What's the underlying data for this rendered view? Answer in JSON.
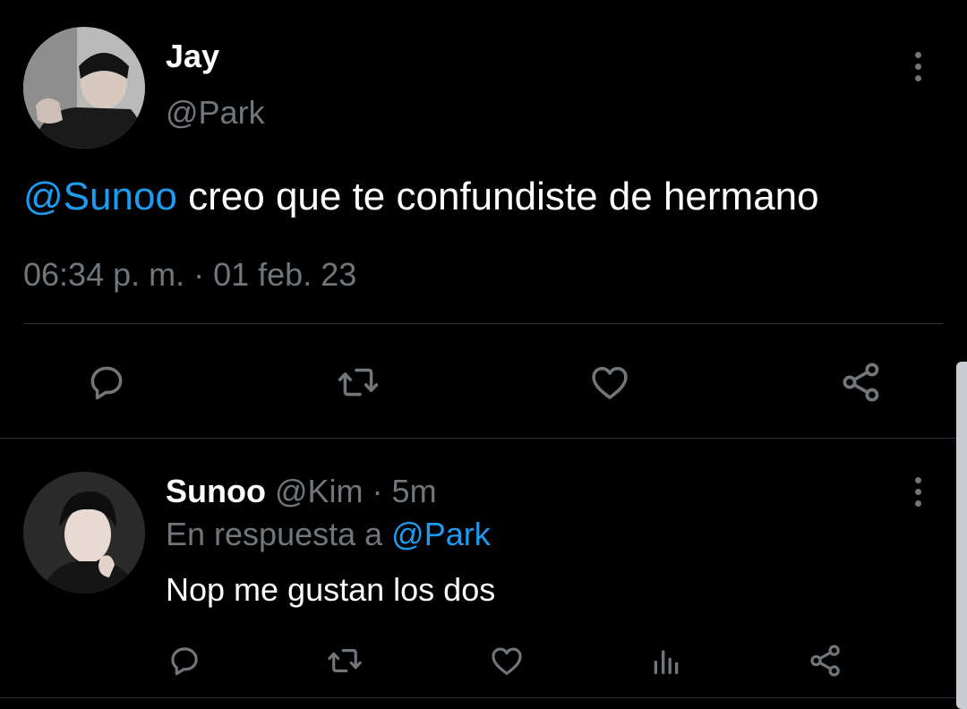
{
  "main_tweet": {
    "author_name": "Jay",
    "author_handle": "@Park",
    "mention": "@Sunoo",
    "text": " creo que te confundiste de hermano",
    "timestamp": "06:34 p. m. · 01 feb. 23",
    "actions": [
      "reply-icon",
      "retweet-icon",
      "like-icon",
      "share-icon"
    ]
  },
  "reply": {
    "author_name": "Sunoo",
    "author_handle": "@Kim",
    "separator": " · ",
    "time": "5m",
    "in_reply_prefix": "En respuesta a ",
    "in_reply_handle": "@Park",
    "text": "Nop me gustan los dos",
    "actions": [
      "reply-icon",
      "retweet-icon",
      "like-icon",
      "analytics-icon",
      "share-icon"
    ]
  },
  "colors": {
    "background": "#000000",
    "text": "#e7e9ea",
    "muted": "#71767b",
    "link": "#1d9bf0",
    "divider": "#2f3336"
  }
}
